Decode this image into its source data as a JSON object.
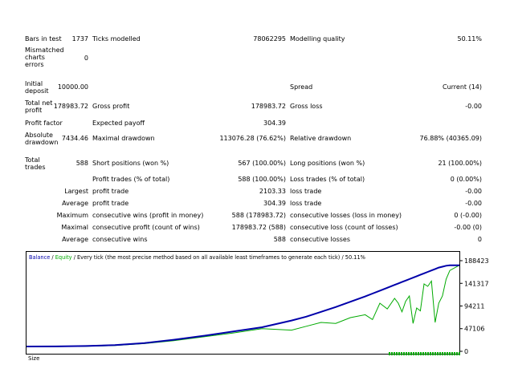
{
  "report": {
    "bars_in_test": {
      "label": "Bars in test",
      "value": "1737"
    },
    "ticks_modelled": {
      "label": "Ticks modelled",
      "value": "78062295"
    },
    "modelling_quality": {
      "label": "Modelling quality",
      "value": "50.11%"
    },
    "mismatched_errors": {
      "label": "Mismatched charts errors",
      "value": "0"
    },
    "initial_deposit": {
      "label": "Initial deposit",
      "value": "10000.00"
    },
    "spread": {
      "label": "Spread",
      "value": "Current (14)"
    },
    "total_net_profit": {
      "label": "Total net profit",
      "value": "178983.72"
    },
    "gross_profit": {
      "label": "Gross profit",
      "value": "178983.72"
    },
    "gross_loss": {
      "label": "Gross loss",
      "value": "-0.00"
    },
    "profit_factor": {
      "label": "Profit factor",
      "value": ""
    },
    "expected_payoff": {
      "label": "Expected payoff",
      "value": "304.39"
    },
    "absolute_drawdown": {
      "label": "Absolute drawdown",
      "value": "7434.46"
    },
    "maximal_drawdown": {
      "label": "Maximal drawdown",
      "value": "113076.28 (76.62%)"
    },
    "relative_drawdown": {
      "label": "Relative drawdown",
      "value": "76.88% (40365.09)"
    },
    "total_trades": {
      "label": "Total trades",
      "value": "588"
    },
    "short_positions": {
      "label": "Short positions (won %)",
      "value": "567 (100.00%)"
    },
    "long_positions": {
      "label": "Long positions (won %)",
      "value": "21 (100.00%)"
    },
    "profit_trades": {
      "label": "Profit trades (% of total)",
      "value": "588 (100.00%)"
    },
    "loss_trades": {
      "label": "Loss trades (% of total)",
      "value": "0 (0.00%)"
    },
    "largest": {
      "prefix": "Largest",
      "profit_label": "profit trade",
      "profit_value": "2103.33",
      "loss_label": "loss trade",
      "loss_value": "-0.00"
    },
    "average": {
      "prefix": "Average",
      "profit_label": "profit trade",
      "profit_value": "304.39",
      "loss_label": "loss trade",
      "loss_value": "-0.00"
    },
    "maximum": {
      "prefix": "Maximum",
      "wins_label": "consecutive wins (profit in money)",
      "wins_value": "588 (178983.72)",
      "losses_label": "consecutive losses (loss in money)",
      "losses_value": "0 (-0.00)"
    },
    "maximal": {
      "prefix": "Maximal",
      "profit_label": "consecutive profit (count of wins)",
      "profit_value": "178983.72 (588)",
      "loss_label": "consecutive loss (count of losses)",
      "loss_value": "-0.00 (0)"
    },
    "average_consec": {
      "prefix": "Average",
      "wins_label": "consecutive wins",
      "wins_value": "588",
      "losses_label": "consecutive losses",
      "losses_value": "0"
    }
  },
  "graph": {
    "legend_balance": "Balance",
    "legend_sep1": " / ",
    "legend_equity": "Equity",
    "legend_rest": " / Every tick (the most precise method based on all available least timeframes to generate each tick) / 50.11%",
    "size_label": "Size",
    "colors": {
      "balance": "#0000aa",
      "equity": "#00aa00",
      "border": "#000000"
    }
  },
  "chart_data": {
    "type": "line",
    "title": "",
    "xlabel": "",
    "ylabel": "",
    "ylim": [
      0,
      188423
    ],
    "yticks": [
      "188423",
      "141317",
      "94211",
      "47106",
      "0"
    ],
    "ytick_values": [
      188423,
      141317,
      94211,
      47106,
      0
    ],
    "x": [
      0,
      40,
      80,
      120,
      160,
      200,
      240,
      280,
      320,
      360,
      380,
      400,
      420,
      440,
      460,
      470,
      480,
      490,
      500,
      505,
      510,
      515,
      520,
      525,
      530,
      535,
      540,
      545,
      550,
      555,
      560,
      565,
      570,
      575,
      588
    ],
    "series": [
      {
        "name": "Balance",
        "values": [
          10000,
          10200,
          11000,
          13000,
          17000,
          24000,
          32000,
          41000,
          50000,
          64000,
          72000,
          82000,
          92000,
          103000,
          114000,
          120000,
          126000,
          132000,
          138000,
          141000,
          144000,
          147000,
          150000,
          153000,
          156000,
          159000,
          162000,
          165000,
          168000,
          171000,
          174000,
          176000,
          178000,
          179000,
          179000
        ]
      },
      {
        "name": "Equity",
        "values": [
          10000,
          9800,
          10500,
          12000,
          16000,
          22000,
          30000,
          38000,
          47000,
          44000,
          52000,
          60000,
          58000,
          70000,
          76000,
          66000,
          100000,
          88000,
          110000,
          100000,
          82000,
          104000,
          115000,
          58000,
          90000,
          84000,
          140000,
          135000,
          146000,
          60000,
          100000,
          115000,
          150000,
          168000,
          179000
        ]
      }
    ],
    "volume_bars": true
  }
}
